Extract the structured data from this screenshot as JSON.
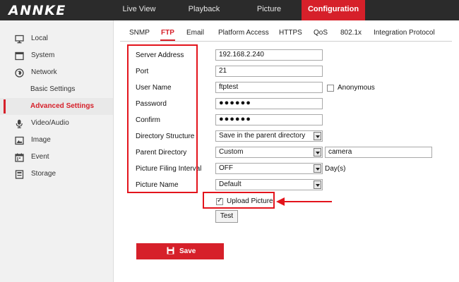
{
  "app": {
    "logo": "ANNKE"
  },
  "nav": {
    "items": [
      {
        "label": "Live View"
      },
      {
        "label": "Playback"
      },
      {
        "label": "Picture"
      },
      {
        "label": "Configuration"
      }
    ]
  },
  "sidebar": {
    "items": [
      {
        "label": "Local",
        "icon": "monitor-icon"
      },
      {
        "label": "System",
        "icon": "system-window-icon"
      },
      {
        "label": "Network",
        "icon": "globe-icon"
      },
      {
        "label": "Basic Settings"
      },
      {
        "label": "Advanced Settings"
      },
      {
        "label": "Video/Audio",
        "icon": "microphone-icon"
      },
      {
        "label": "Image",
        "icon": "image-icon"
      },
      {
        "label": "Event",
        "icon": "calendar-icon"
      },
      {
        "label": "Storage",
        "icon": "storage-icon"
      }
    ]
  },
  "tabs": [
    {
      "label": "SNMP"
    },
    {
      "label": "FTP"
    },
    {
      "label": "Email"
    },
    {
      "label": "Platform Access"
    },
    {
      "label": "HTTPS"
    },
    {
      "label": "QoS"
    },
    {
      "label": "802.1x"
    },
    {
      "label": "Integration Protocol"
    }
  ],
  "form": {
    "server_address": {
      "label": "Server Address",
      "value": "192.168.2.240"
    },
    "port": {
      "label": "Port",
      "value": "21"
    },
    "user_name": {
      "label": "User Name",
      "value": "ftptest",
      "anonymous_label": "Anonymous"
    },
    "password": {
      "label": "Password",
      "value": "●●●●●●"
    },
    "confirm": {
      "label": "Confirm",
      "value": "●●●●●●"
    },
    "directory_structure": {
      "label": "Directory Structure",
      "value": "Save in the parent directory"
    },
    "parent_directory": {
      "label": "Parent Directory",
      "value": "Custom",
      "custom_value": "camera"
    },
    "picture_filing_interval": {
      "label": "Picture Filing Interval",
      "value": "OFF",
      "unit": "Day(s)"
    },
    "picture_name": {
      "label": "Picture Name",
      "value": "Default"
    },
    "upload_picture": {
      "label": "Upload Picture",
      "checked": true
    },
    "test_label": "Test",
    "save_label": "Save"
  },
  "colors": {
    "accent": "#d6202a",
    "topbar": "#2b2b2b",
    "sidebar_bg": "#f1f1f1",
    "annotation": "#e3141c"
  }
}
